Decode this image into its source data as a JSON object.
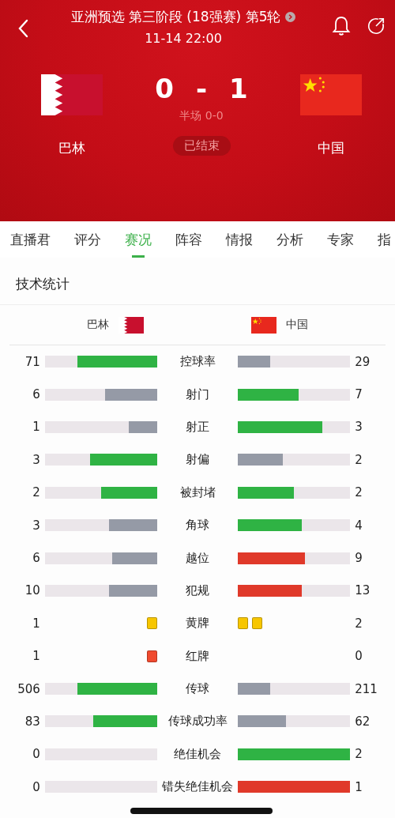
{
  "header": {
    "title": "亚洲预选 第三阶段 (18强赛) 第5轮",
    "datetime": "11-14 22:00",
    "home": {
      "name": "巴林",
      "flag": {
        "kind": "bahrain"
      }
    },
    "away": {
      "name": "中国",
      "flag": {
        "kind": "china"
      }
    },
    "score_home": "0",
    "score_separator": "-",
    "score_away": "1",
    "halftime": "半场 0-0",
    "status": "已结束"
  },
  "tabs": [
    {
      "label": "直播君",
      "selected": false
    },
    {
      "label": "评分",
      "selected": false
    },
    {
      "label": "赛况",
      "selected": true
    },
    {
      "label": "阵容",
      "selected": false
    },
    {
      "label": "情报",
      "selected": false
    },
    {
      "label": "分析",
      "selected": false
    },
    {
      "label": "专家",
      "selected": false
    },
    {
      "label": "指",
      "selected": false
    }
  ],
  "section_title": "技术统计",
  "teams_header": {
    "home": {
      "name": "巴林",
      "flag": {
        "kind": "bahrain"
      }
    },
    "away": {
      "name": "中国",
      "flag": {
        "kind": "china"
      }
    }
  },
  "stats": [
    {
      "kind": "bar",
      "label": "控球率",
      "home": {
        "value": "71",
        "level": 0.71,
        "color": "#2fb344"
      },
      "away": {
        "value": "29",
        "level": 0.29,
        "color": "#959aa6"
      }
    },
    {
      "kind": "bar",
      "label": "射门",
      "home": {
        "value": "6",
        "level": 0.46,
        "color": "#959aa6"
      },
      "away": {
        "value": "7",
        "level": 0.54,
        "color": "#2fb344"
      }
    },
    {
      "kind": "bar",
      "label": "射正",
      "home": {
        "value": "1",
        "level": 0.25,
        "color": "#959aa6"
      },
      "away": {
        "value": "3",
        "level": 0.75,
        "color": "#2fb344"
      }
    },
    {
      "kind": "bar",
      "label": "射偏",
      "home": {
        "value": "3",
        "level": 0.6,
        "color": "#2fb344"
      },
      "away": {
        "value": "2",
        "level": 0.4,
        "color": "#959aa6"
      }
    },
    {
      "kind": "bar",
      "label": "被封堵",
      "home": {
        "value": "2",
        "level": 0.5,
        "color": "#2fb344"
      },
      "away": {
        "value": "2",
        "level": 0.5,
        "color": "#2fb344"
      }
    },
    {
      "kind": "bar",
      "label": "角球",
      "home": {
        "value": "3",
        "level": 0.43,
        "color": "#959aa6"
      },
      "away": {
        "value": "4",
        "level": 0.57,
        "color": "#2fb344"
      }
    },
    {
      "kind": "bar",
      "label": "越位",
      "home": {
        "value": "6",
        "level": 0.4,
        "color": "#959aa6"
      },
      "away": {
        "value": "9",
        "level": 0.6,
        "color": "#e0392a"
      }
    },
    {
      "kind": "bar",
      "label": "犯规",
      "home": {
        "value": "10",
        "level": 0.43,
        "color": "#959aa6"
      },
      "away": {
        "value": "13",
        "level": 0.57,
        "color": "#e0392a"
      }
    },
    {
      "kind": "cards",
      "label": "黄牌",
      "home": {
        "value": "1",
        "cards": [
          {
            "color": "#f7c600"
          }
        ]
      },
      "away": {
        "value": "2",
        "cards": [
          {
            "color": "#f7c600"
          },
          {
            "color": "#f7c600"
          }
        ]
      }
    },
    {
      "kind": "cards",
      "label": "红牌",
      "home": {
        "value": "1",
        "cards": [
          {
            "color": "#f04a2f"
          }
        ]
      },
      "away": {
        "value": "0"
      }
    },
    {
      "kind": "bar",
      "label": "传球",
      "home": {
        "value": "506",
        "level": 0.71,
        "color": "#2fb344"
      },
      "away": {
        "value": "211",
        "level": 0.29,
        "color": "#959aa6"
      }
    },
    {
      "kind": "bar",
      "label": "传球成功率",
      "home": {
        "value": "83",
        "level": 0.57,
        "color": "#2fb344"
      },
      "away": {
        "value": "62",
        "level": 0.43,
        "color": "#959aa6"
      }
    },
    {
      "kind": "bar",
      "label": "绝佳机会",
      "home": {
        "value": "0"
      },
      "away": {
        "value": "2",
        "level": 1,
        "color": "#2fb344"
      }
    },
    {
      "kind": "bar",
      "label": "错失绝佳机会",
      "home": {
        "value": "0"
      },
      "away": {
        "value": "1",
        "level": 1,
        "color": "#e0392a"
      }
    }
  ]
}
